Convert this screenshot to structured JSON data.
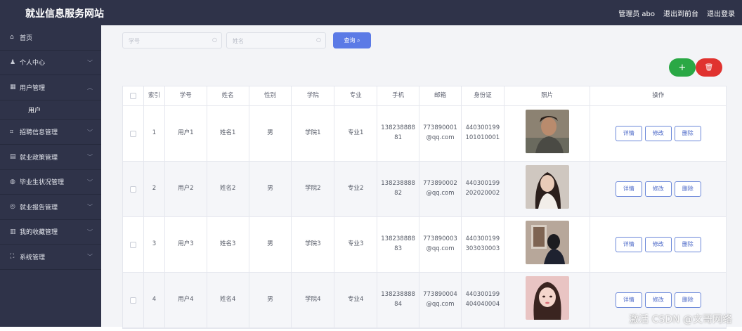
{
  "header": {
    "title": "就业信息服务网站",
    "links": [
      "管理员 abo",
      "退出到前台",
      "退出登录"
    ]
  },
  "sidebar": {
    "items": [
      {
        "label": "首页",
        "icon": "home-icon",
        "glyph": "⌂",
        "chevron": false
      },
      {
        "label": "个人中心",
        "icon": "user-icon",
        "glyph": "♟",
        "chevron": true
      },
      {
        "label": "用户管理",
        "icon": "grid-icon",
        "glyph": "▦",
        "chevron": true,
        "expanded": true,
        "sub": [
          "用户"
        ]
      },
      {
        "label": "招聘信息管理",
        "icon": "crop-icon",
        "glyph": "⌗",
        "chevron": true
      },
      {
        "label": "就业政策管理",
        "icon": "building-icon",
        "glyph": "▤",
        "chevron": true
      },
      {
        "label": "毕业生状况管理",
        "icon": "bulb-icon",
        "glyph": "◍",
        "chevron": true
      },
      {
        "label": "就业报告管理",
        "icon": "compass-icon",
        "glyph": "◎",
        "chevron": true
      },
      {
        "label": "我的收藏管理",
        "icon": "trash-icon",
        "glyph": "▥",
        "chevron": true
      },
      {
        "label": "系统管理",
        "icon": "expand-icon",
        "glyph": "⛶",
        "chevron": true
      }
    ]
  },
  "search": {
    "student_no_placeholder": "学号",
    "name_placeholder": "姓名",
    "button_label": "查询"
  },
  "actions": {
    "add_label": "+",
    "delete_label": "🗑"
  },
  "table": {
    "headers": [
      "",
      "索引",
      "学号",
      "姓名",
      "性别",
      "学院",
      "专业",
      "手机",
      "邮箱",
      "身份证",
      "照片",
      "操作"
    ],
    "rows": [
      {
        "index": "1",
        "student_no": "用户1",
        "name": "姓名1",
        "gender": "男",
        "college": "学院1",
        "major": "专业1",
        "phone": "13823888881",
        "email": "773890001@qq.com",
        "id_card": "440300199101010001"
      },
      {
        "index": "2",
        "student_no": "用户2",
        "name": "姓名2",
        "gender": "男",
        "college": "学院2",
        "major": "专业2",
        "phone": "13823888882",
        "email": "773890002@qq.com",
        "id_card": "440300199202020002"
      },
      {
        "index": "3",
        "student_no": "用户3",
        "name": "姓名3",
        "gender": "男",
        "college": "学院3",
        "major": "专业3",
        "phone": "13823888883",
        "email": "773890003@qq.com",
        "id_card": "440300199303030003"
      },
      {
        "index": "4",
        "student_no": "用户4",
        "name": "姓名4",
        "gender": "男",
        "college": "学院4",
        "major": "专业4",
        "phone": "13823888884",
        "email": "773890004@qq.com",
        "id_card": "440300199404040004"
      }
    ],
    "op_labels": {
      "detail": "详情",
      "edit": "修改",
      "delete": "删除"
    }
  },
  "watermark": "激活 CSDN @文哥网络",
  "colors": {
    "sidebar_bg": "#2f3349",
    "primary": "#5b7ae6",
    "add": "#2aa845",
    "delete": "#e0322f"
  }
}
